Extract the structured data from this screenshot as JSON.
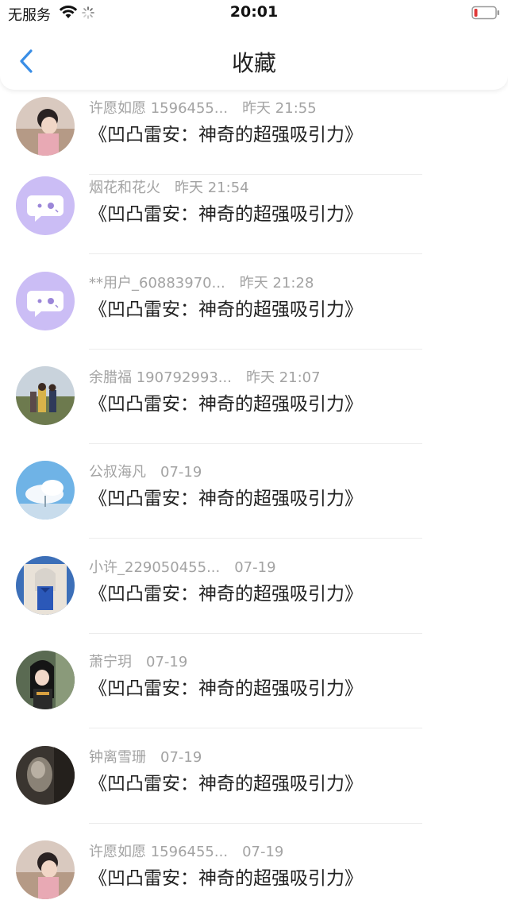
{
  "status_bar": {
    "carrier": "无服务",
    "time": "20:01"
  },
  "nav": {
    "title": "收藏",
    "back_icon": "chevron-left-icon"
  },
  "colors": {
    "accent": "#3a8ee6",
    "battery_low": "#e03a3a",
    "placeholder_avatar": "#cbbdf5",
    "meta_text": "#a3a3a3"
  },
  "items": [
    {
      "user": "许愿如愿 1596455...",
      "time": "昨天 21:55",
      "content": "《凹凸雷安：神奇的超强吸引力》",
      "avatar": "photo-girl"
    },
    {
      "user": "烟花和花火",
      "time": "昨天 21:54",
      "content": "《凹凸雷安：神奇的超强吸引力》",
      "avatar": "default-chat"
    },
    {
      "user": "**用户_60883970...",
      "time": "昨天 21:28",
      "content": "《凹凸雷安：神奇的超强吸引力》",
      "avatar": "default-chat"
    },
    {
      "user": "余腊福 190792993...",
      "time": "昨天 21:07",
      "content": "《凹凸雷安：神奇的超强吸引力》",
      "avatar": "photo-family"
    },
    {
      "user": "公叔海凡",
      "time": "07-19",
      "content": "《凹凸雷安：神奇的超强吸引力》",
      "avatar": "photo-sky"
    },
    {
      "user": "小许_229050455...",
      "time": "07-19",
      "content": "《凹凸雷安：神奇的超强吸引力》",
      "avatar": "anime-blue"
    },
    {
      "user": "萧宁玥",
      "time": "07-19",
      "content": "《凹凸雷安：神奇的超强吸引力》",
      "avatar": "anime-dark"
    },
    {
      "user": "钟离雪珊",
      "time": "07-19",
      "content": "《凹凸雷安：神奇的超强吸引力》",
      "avatar": "photo-gray"
    },
    {
      "user": "许愿如愿 1596455...",
      "time": "07-19",
      "content": "《凹凸雷安：神奇的超强吸引力》",
      "avatar": "photo-girl"
    }
  ]
}
